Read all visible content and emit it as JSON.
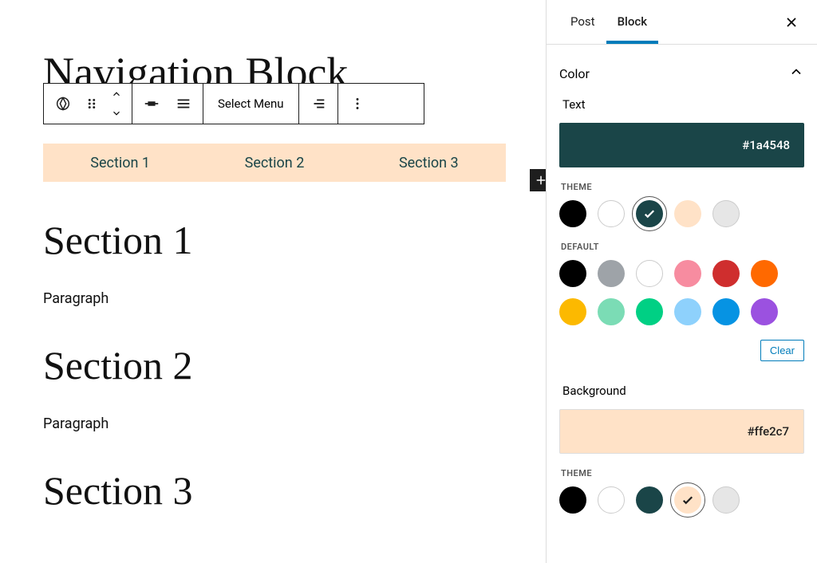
{
  "editor": {
    "page_title": "Navigation Block",
    "toolbar": {
      "select_menu_label": "Select Menu"
    },
    "nav_items": [
      "Section 1",
      "Section 2",
      "Section 3"
    ],
    "sections": [
      {
        "heading": "Section 1",
        "paragraph": "Paragraph"
      },
      {
        "heading": "Section 2",
        "paragraph": "Paragraph"
      },
      {
        "heading": "Section 3",
        "paragraph": ""
      }
    ]
  },
  "sidebar": {
    "tabs": {
      "post": "Post",
      "block": "Block",
      "active": "block"
    },
    "panel": {
      "title": "Color",
      "text": {
        "label": "Text",
        "value": "#1a4548",
        "theme_label": "THEME",
        "theme_swatches": [
          {
            "color": "#000000",
            "selected": false,
            "bordered": false
          },
          {
            "color": "#ffffff",
            "selected": false,
            "bordered": true
          },
          {
            "color": "#1a4548",
            "selected": true,
            "bordered": false,
            "check_color": "#fff"
          },
          {
            "color": "#ffe2c7",
            "selected": false,
            "bordered": false
          },
          {
            "color": "#e6e6e6",
            "selected": false,
            "bordered": true
          }
        ],
        "default_label": "DEFAULT",
        "default_swatches": [
          {
            "color": "#000000"
          },
          {
            "color": "#9ea3a8"
          },
          {
            "color": "#ffffff",
            "bordered": true
          },
          {
            "color": "#f78ca0"
          },
          {
            "color": "#cf2e2e"
          },
          {
            "color": "#ff6900"
          },
          {
            "color": "#fcb900"
          },
          {
            "color": "#7bdcb5"
          },
          {
            "color": "#00d084"
          },
          {
            "color": "#8ed1fc"
          },
          {
            "color": "#0693e3"
          },
          {
            "color": "#9b51e0"
          }
        ],
        "clear_label": "Clear"
      },
      "background": {
        "label": "Background",
        "value": "#ffe2c7",
        "theme_label": "THEME",
        "theme_swatches": [
          {
            "color": "#000000",
            "selected": false,
            "bordered": false
          },
          {
            "color": "#ffffff",
            "selected": false,
            "bordered": true
          },
          {
            "color": "#1a4548",
            "selected": false,
            "bordered": false
          },
          {
            "color": "#ffe2c7",
            "selected": true,
            "bordered": false,
            "check_color": "#1e1e1e"
          },
          {
            "color": "#e6e6e6",
            "selected": false,
            "bordered": true
          }
        ]
      }
    }
  }
}
